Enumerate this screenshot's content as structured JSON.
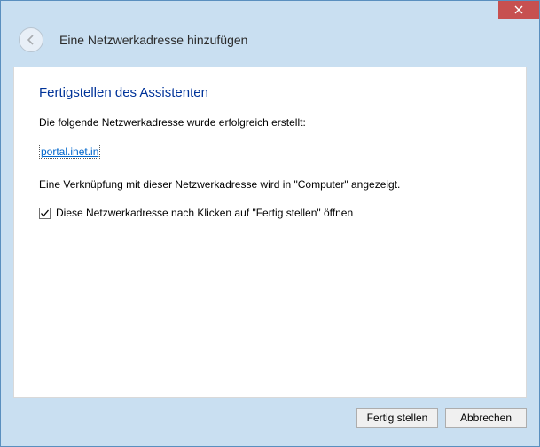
{
  "window": {
    "title": "Eine Netzwerkadresse hinzufügen"
  },
  "content": {
    "heading": "Fertigstellen des Assistenten",
    "success_text": "Die folgende Netzwerkadresse wurde erfolgreich erstellt:",
    "address": "portal.inet.in",
    "shortcut_text": "Eine Verknüpfung mit dieser Netzwerkadresse wird in \"Computer\" angezeigt.",
    "checkbox_label": "Diese Netzwerkadresse nach Klicken auf \"Fertig stellen\" öffnen",
    "checkbox_checked": true
  },
  "footer": {
    "finish": "Fertig stellen",
    "cancel": "Abbrechen"
  }
}
